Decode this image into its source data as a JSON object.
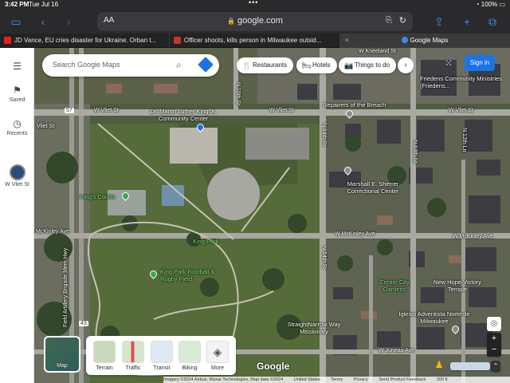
{
  "status": {
    "time": "3:42 PM",
    "date": "Tue Jul 16",
    "battery": "100%"
  },
  "browser": {
    "aa_label": "AA",
    "url": "google.com",
    "tabs": [
      {
        "title": "JD Vance, EU cries disaster for Ukraine. Orban t...",
        "favicon_color": "#e62117"
      },
      {
        "title": "Officer shoots, kills person in Milwaukee outsid...",
        "favicon_color": "#c0392b"
      },
      {
        "title": "Google Maps",
        "favicon_color": "#4285f4"
      }
    ]
  },
  "maps": {
    "search_placeholder": "Search Google Maps",
    "rail": [
      {
        "label": "Saved",
        "icon": "bookmark-icon"
      },
      {
        "label": "Recents",
        "icon": "history-icon"
      },
      {
        "label": "W Vliet St",
        "icon": "place-thumbnail-icon"
      }
    ],
    "chips": [
      {
        "label": "Restaurants",
        "icon": "fork-knife-icon"
      },
      {
        "label": "Hotels",
        "icon": "bed-icon"
      },
      {
        "label": "Things to do",
        "icon": "camera-icon"
      }
    ],
    "sign_in": "Sign in",
    "layers": {
      "map_label": "Map",
      "options": [
        "Terrain",
        "Traffic",
        "Transit",
        "Biking",
        "More"
      ]
    },
    "logo": "Google",
    "attribution": [
      "Imagery ©2024 Airbus, Maxar Technologies, Map data ©2024",
      "United States",
      "Terms",
      "Privacy",
      "Send Product Feedback",
      "200 ft"
    ],
    "labels": {
      "w_kneeland_st": "W Kneeland St",
      "w_vliet_st_a": "W Vliet St",
      "w_vliet_st_b": "W Vliet St",
      "w_vliet_st_c": "W Vliet St",
      "n_15th_st": "N 15th St",
      "n_14th_st_a": "N 14th St",
      "n_14th_st_b": "N 14th St",
      "n_13th_st": "N 13th St",
      "n_12th_ln": "N 12th Ln",
      "w_mckinley_ave_a": "W McKinley Ave",
      "w_mckinley_ave_b": "W McKinley Ave",
      "mckinley_ave_left": "McKinley Ave",
      "w_juneau_ave": "W Juneau Ave",
      "vliet_st_left": "Vliet St",
      "freeway": "Field Artillery Brigade Mem Hwy",
      "mlk_center": "Dr. Martin Luther King Jr. Community Center",
      "repairers": "Repairers of the Breach",
      "friedens": "Friedens Community Ministries (Friedens...",
      "marshall": "Marshall E. Sherrer Correctional Center",
      "kings_courts": "King's Courts",
      "king_park": "King Park",
      "football": "King Park Football & Rugby Field",
      "cream_city": "Cream City Gardens",
      "new_hope": "New Hope Victory Temple",
      "straightnarrow": "StraightNarrow Way Missionary",
      "iglesia": "Iglesia Adventista Norte de Milwaukee",
      "hwy_43": "43",
      "hwy_57": "57"
    }
  }
}
